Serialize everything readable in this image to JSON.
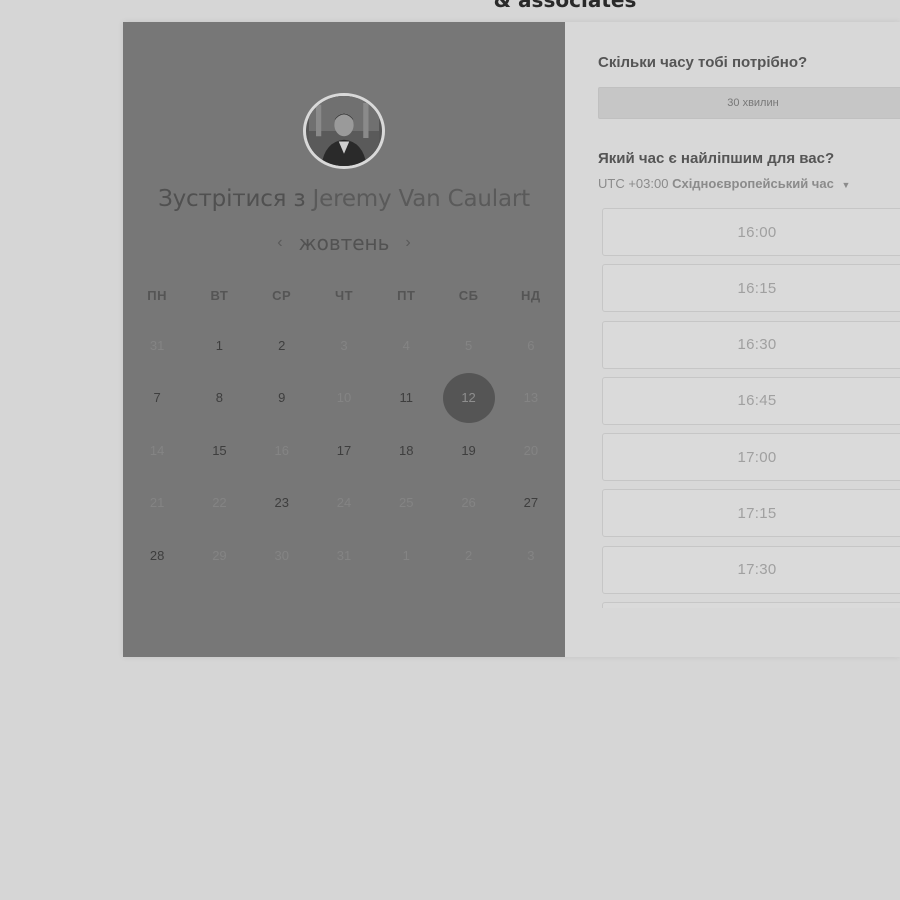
{
  "header": {
    "brand_partial": "& associates"
  },
  "host": {
    "title_prefix": "Зустрітися з",
    "name": "Jeremy Van Caulart"
  },
  "calendar": {
    "month": "жовтень",
    "prev_icon": "chevron-left-icon",
    "next_icon": "chevron-right-icon",
    "weekdays": [
      "ПН",
      "ВТ",
      "СР",
      "ЧТ",
      "ПТ",
      "СБ",
      "НД"
    ],
    "selected_day": "12",
    "weeks": [
      [
        {
          "d": "31",
          "s": "muted"
        },
        {
          "d": "1",
          "s": "active"
        },
        {
          "d": "2",
          "s": "active"
        },
        {
          "d": "3",
          "s": "muted"
        },
        {
          "d": "4",
          "s": "muted"
        },
        {
          "d": "5",
          "s": "muted"
        },
        {
          "d": "6",
          "s": "muted"
        }
      ],
      [
        {
          "d": "7",
          "s": "active"
        },
        {
          "d": "8",
          "s": "active"
        },
        {
          "d": "9",
          "s": "active"
        },
        {
          "d": "10",
          "s": "muted"
        },
        {
          "d": "11",
          "s": "active"
        },
        {
          "d": "12",
          "s": "selected"
        },
        {
          "d": "13",
          "s": "muted"
        }
      ],
      [
        {
          "d": "14",
          "s": "muted"
        },
        {
          "d": "15",
          "s": "active"
        },
        {
          "d": "16",
          "s": "muted"
        },
        {
          "d": "17",
          "s": "active"
        },
        {
          "d": "18",
          "s": "active"
        },
        {
          "d": "19",
          "s": "active"
        },
        {
          "d": "20",
          "s": "muted"
        }
      ],
      [
        {
          "d": "21",
          "s": "muted"
        },
        {
          "d": "22",
          "s": "muted"
        },
        {
          "d": "23",
          "s": "active"
        },
        {
          "d": "24",
          "s": "muted"
        },
        {
          "d": "25",
          "s": "muted"
        },
        {
          "d": "26",
          "s": "muted"
        },
        {
          "d": "27",
          "s": "active"
        }
      ],
      [
        {
          "d": "28",
          "s": "active"
        },
        {
          "d": "29",
          "s": "muted"
        },
        {
          "d": "30",
          "s": "muted"
        },
        {
          "d": "31",
          "s": "muted"
        },
        {
          "d": "1",
          "s": "muted"
        },
        {
          "d": "2",
          "s": "muted"
        },
        {
          "d": "3",
          "s": "muted"
        }
      ]
    ]
  },
  "booking": {
    "duration_question": "Скільки часу тобі потрібно?",
    "duration_value": "30 хвилин",
    "time_question": "Який час є найліпшим для вас?",
    "timezone_offset": "UTC +03:00",
    "timezone_name": "Східноєвропейський час",
    "timezone_caret": "▼",
    "slots": [
      "16:00",
      "16:15",
      "16:30",
      "16:45",
      "17:00",
      "17:15",
      "17:30",
      ""
    ]
  },
  "colors": {
    "left_panel": "#777777",
    "right_panel": "#d8d8d8",
    "selected_day": "#555555",
    "page_bg": "#d6d6d6"
  }
}
